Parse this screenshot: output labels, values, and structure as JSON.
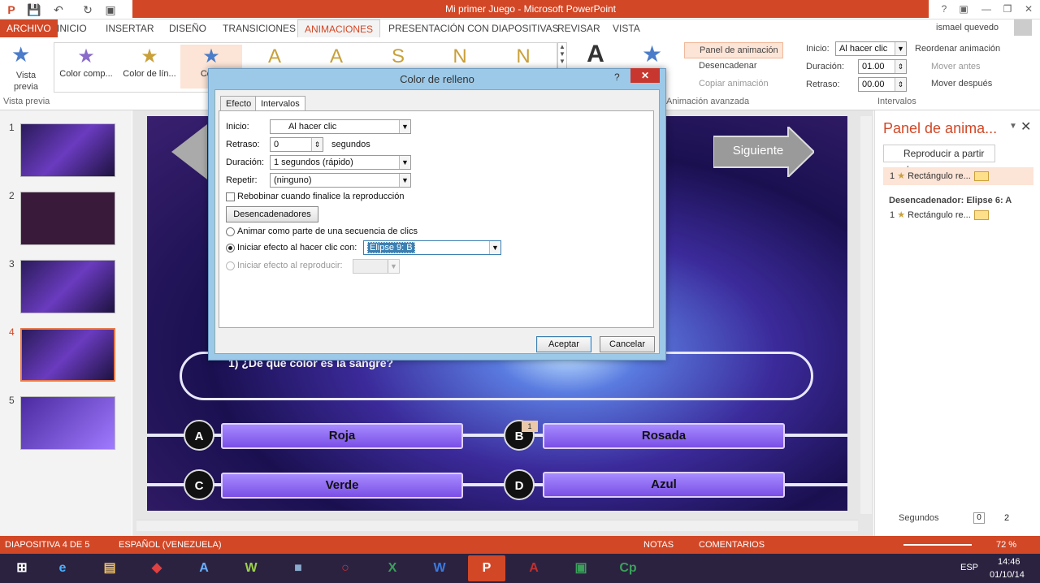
{
  "window": {
    "title": "Mi primer Juego - Microsoft PowerPoint",
    "user": "ismael quevedo"
  },
  "menu": [
    "ARCHIVO",
    "INICIO",
    "INSERTAR",
    "DISEÑO",
    "TRANSICIONES",
    "ANIMACIONES",
    "PRESENTACIÓN CON DIAPOSITIVAS",
    "REVISAR",
    "VISTA"
  ],
  "ribbon": {
    "preview_label": "Vista previa",
    "preview_group": "Vista previa",
    "gallery": [
      "Color comp...",
      "Color de lín...",
      "Color"
    ],
    "gallery_letters": [
      "A",
      "A",
      "S",
      "N",
      "N"
    ],
    "pane_btn": "Panel de animación",
    "trigger_btn": "Desencadenar",
    "copy_btn": "Copiar animación",
    "adv_group": "Animación avanzada",
    "start_label": "Inicio:",
    "start_value": "Al hacer clic",
    "duration_label": "Duración:",
    "duration_value": "01.00",
    "delay_label": "Retraso:",
    "delay_value": "00.00",
    "reorder_title": "Reordenar animación",
    "move_before": "Mover antes",
    "move_after": "Mover después",
    "timing_group": "Intervalos"
  },
  "slides": [
    "1",
    "2",
    "3",
    "4",
    "5"
  ],
  "slide": {
    "next_label": "Siguiente",
    "question": "1) ¿De qué color es la sangre?",
    "answers": [
      {
        "letter": "A",
        "text": "Roja"
      },
      {
        "letter": "B",
        "text": "Rosada"
      },
      {
        "letter": "C",
        "text": "Verde"
      },
      {
        "letter": "D",
        "text": "Azul"
      }
    ],
    "b_badge": "1"
  },
  "anim_pane": {
    "title": "Panel de anima...",
    "play_btn": "Reproducir a partir de",
    "item1_num": "1",
    "item1": "Rectángulo re...",
    "trigger_header": "Desencadenador: Elipse 6: A",
    "item2_num": "1",
    "item2": "Rectángulo re...",
    "seconds": "Segundos",
    "page_from": "0",
    "page_to": "2"
  },
  "dialog": {
    "title": "Color de relleno",
    "tabs": [
      "Efecto",
      "Intervalos"
    ],
    "start_label": "Inicio:",
    "start_value": "Al hacer clic",
    "delay_label": "Retraso:",
    "delay_value": "0",
    "delay_unit": "segundos",
    "duration_label": "Duración:",
    "duration_value": "1 segundos (rápido)",
    "repeat_label": "Repetir:",
    "repeat_value": "(ninguno)",
    "rewind_label": "Rebobinar cuando finalice la reproducción",
    "triggers_btn": "Desencadenadores",
    "opt1": "Animar como parte de una secuencia de clics",
    "opt2": "Iniciar efecto al hacer clic con:",
    "opt2_value": "Elipse 9: B",
    "opt3": "Iniciar efecto al reproducir:",
    "ok": "Aceptar",
    "cancel": "Cancelar",
    "help": "?"
  },
  "status": {
    "slide_info": "DIAPOSITIVA 4 DE 5",
    "language": "ESPAÑOL (VENEZUELA)",
    "notes": "NOTAS",
    "comments": "COMENTARIOS",
    "zoom": "72 %"
  },
  "taskbar": {
    "lang": "ESP",
    "time": "14:46",
    "date": "01/10/14"
  }
}
